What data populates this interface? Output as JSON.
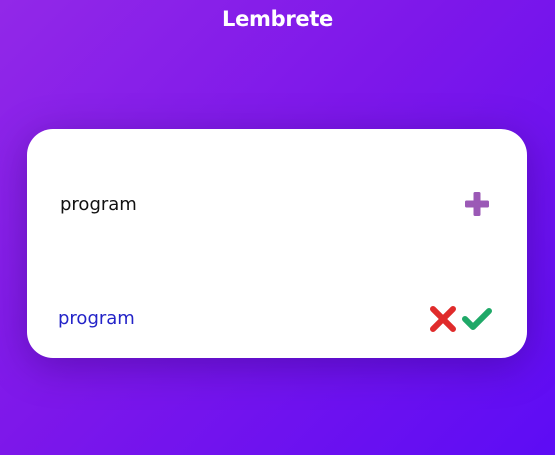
{
  "app": {
    "title": "Lembrete"
  },
  "input": {
    "value": "program",
    "placeholder": ""
  },
  "icons": {
    "add": "plus-icon",
    "delete": "cross-icon",
    "done": "check-icon"
  },
  "colors": {
    "background_start": "#9228e8",
    "background_end": "#5d0cf5",
    "add_icon": "#9b59b6",
    "delete_icon": "#e02b2b",
    "done_icon": "#1fa968",
    "item_text": "#2323c8"
  },
  "items": [
    {
      "text": "program"
    }
  ]
}
